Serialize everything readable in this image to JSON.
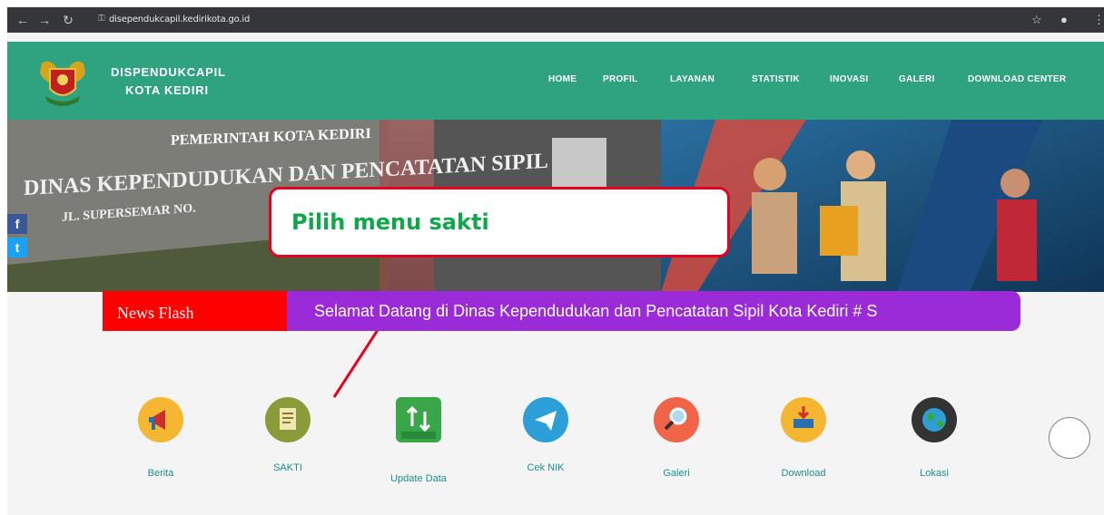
{
  "browser": {
    "url": "disependukcapil.kedirikota.go.id"
  },
  "header": {
    "brand_line1": "DISPENDUKCAPIL",
    "brand_line2": "KOTA KEDIRI",
    "menu": [
      "HOME",
      "PROFIL",
      "LAYANAN",
      "STATISTIK",
      "INOVASI",
      "GALERI",
      "DOWNLOAD CENTER"
    ],
    "color": "#2fa37f"
  },
  "banner": {
    "sign_line1": "PEMERINTAH KOTA KEDIRI",
    "sign_line2": "DINAS KEPENDUDUKAN DAN PENCATATAN SIPIL",
    "sign_line3": "JL. SUPERSEMAR NO."
  },
  "callout": {
    "text": "Pilih menu sakti"
  },
  "news": {
    "label": "News Flash",
    "ticker": "Selamat Datang di Dinas Kependudukan dan Pencatatan Sipil Kota Kediri # S"
  },
  "services": [
    {
      "label": "Berita",
      "icon": "megaphone-icon",
      "color": "#f5b731"
    },
    {
      "label": "SAKTI",
      "icon": "document-icon",
      "color": "#8a9c3a"
    },
    {
      "label": "Update Data",
      "icon": "update-icon",
      "color": "#3aa64a"
    },
    {
      "label": "Cek NIK",
      "icon": "paper-plane-icon",
      "color": "#2d9fd8"
    },
    {
      "label": "Galeri",
      "icon": "magnifier-icon",
      "color": "#f06547"
    },
    {
      "label": "Download",
      "icon": "download-icon",
      "color": "#f5b731"
    },
    {
      "label": "Lokasi",
      "icon": "globe-icon",
      "color": "#333333"
    }
  ]
}
